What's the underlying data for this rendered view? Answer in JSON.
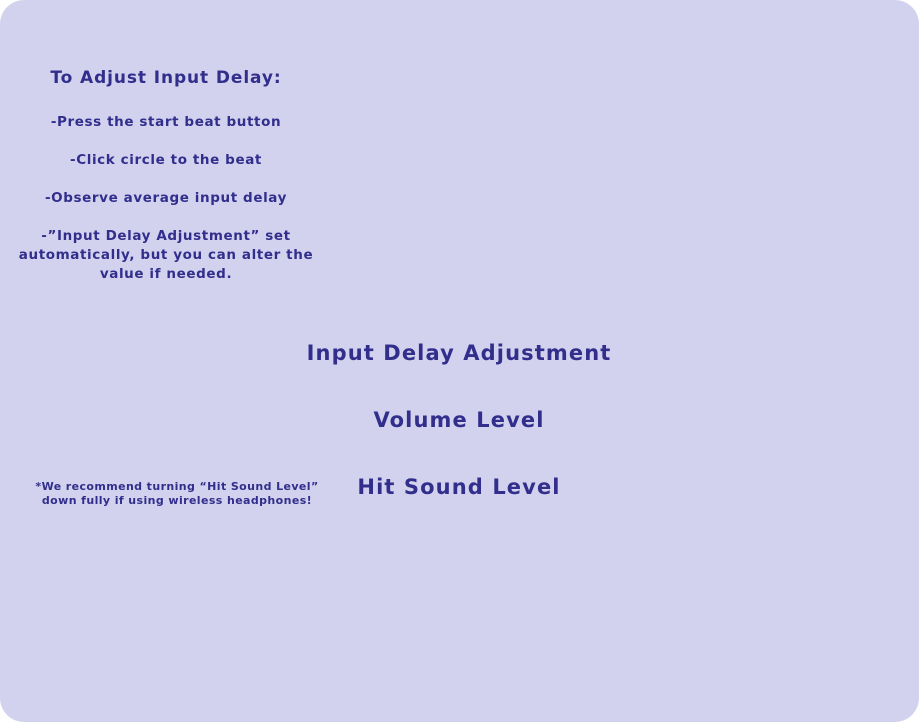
{
  "instructions": {
    "title": "To Adjust Input Delay:",
    "steps": [
      "-Press the start beat button",
      "-Click circle to the beat",
      "-Observe average input delay",
      "-”Input Delay Adjustment” set automatically, but you can alter the value if needed."
    ]
  },
  "settings": {
    "input_delay_label": "Input Delay Adjustment",
    "volume_label": "Volume Level",
    "hit_sound_label": "Hit Sound Level"
  },
  "note": {
    "line1": "*We recommend turning “Hit Sound Level”",
    "line2": "down fully if using wireless headphones!"
  },
  "colors": {
    "panel_background": "#d3d2ee",
    "text": "#312e8c"
  }
}
